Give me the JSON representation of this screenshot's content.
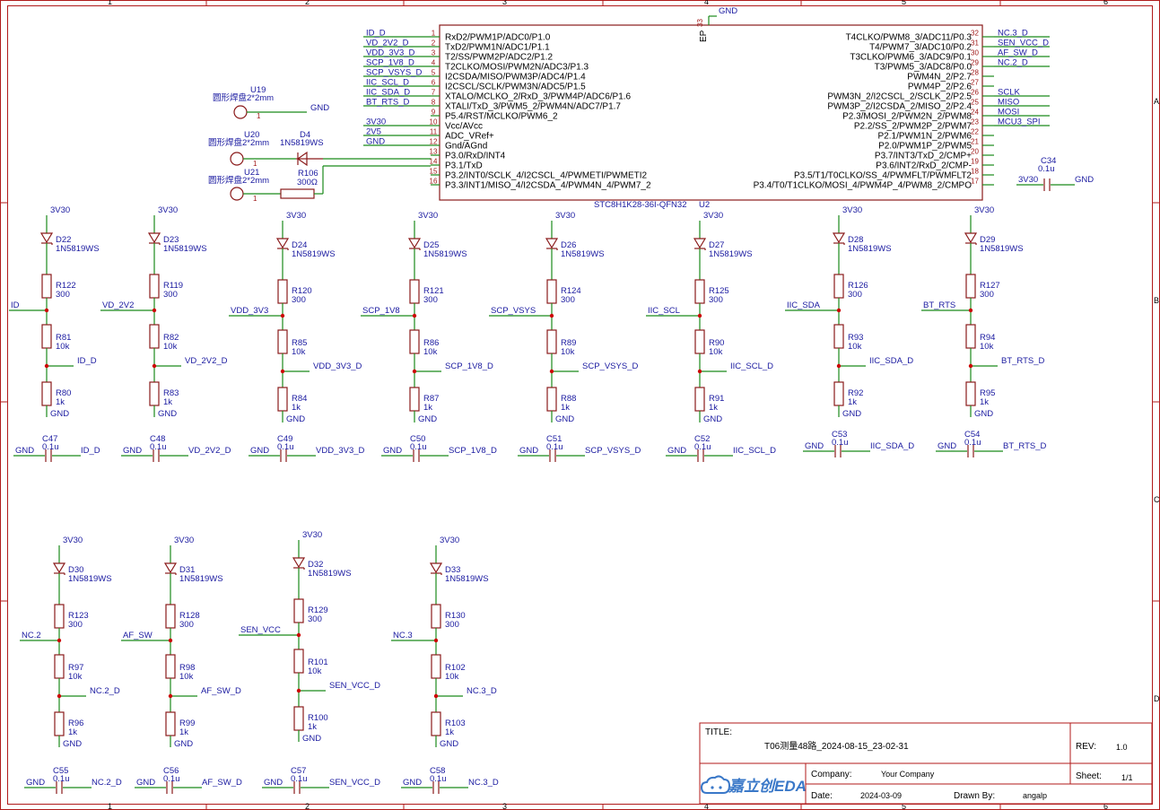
{
  "frame": {
    "cols": [
      "1",
      "2",
      "3",
      "4",
      "5",
      "6"
    ],
    "rows": [
      "A",
      "B",
      "C",
      "D"
    ]
  },
  "mcu": {
    "ref": "U2",
    "part": "STC8H1K28-36I-QFN32",
    "ep_label": "EP",
    "ep_pin": "33",
    "ep_net": "GND",
    "left_pins": [
      {
        "num": "1",
        "name": "RxD2/PWM1P/ADC0/P1.0",
        "net": "ID_D"
      },
      {
        "num": "2",
        "name": "TxD2/PWM1N/ADC1/P1.1",
        "net": "VD_2V2_D"
      },
      {
        "num": "3",
        "name": "T2/SS/PWM2P/ADC2/P1.2",
        "net": "VDD_3V3_D"
      },
      {
        "num": "4",
        "name": "T2CLKO/MOSI/PWM2N/ADC3/P1.3",
        "net": "SCP_1V8_D"
      },
      {
        "num": "5",
        "name": "I2CSDA/MISO/PWM3P/ADC4/P1.4",
        "net": "SCP_VSYS_D"
      },
      {
        "num": "6",
        "name": "I2CSCL/SCLK/PWM3N/ADC5/P1.5",
        "net": "IIC_SCL_D"
      },
      {
        "num": "7",
        "name": "XTALO/MCLKO_2/RxD_3/PWM4P/ADC6/P1.6",
        "net": "IIC_SDA_D"
      },
      {
        "num": "8",
        "name": "XTALI/TxD_3/PWM5_2/PWM4N/ADC7/P1.7",
        "net": "BT_RTS_D"
      },
      {
        "num": "9",
        "name": "P5.4/RST/MCLKO/PWM6_2",
        "net": ""
      },
      {
        "num": "10",
        "name": "Vcc/AVcc",
        "net": "3V30"
      },
      {
        "num": "11",
        "name": "ADC_VRef+",
        "net": "2V5"
      },
      {
        "num": "12",
        "name": "Gnd/AGnd",
        "net": "GND"
      },
      {
        "num": "13",
        "name": "P3.0/RxD/INT4",
        "net": ""
      },
      {
        "num": "14",
        "name": "P3.1/TxD",
        "net": ""
      },
      {
        "num": "15",
        "name": "P3.2/INT0/SCLK_4/I2CSCL_4/PWMETI/PWMETI2",
        "net": ""
      },
      {
        "num": "16",
        "name": "P3.3/INT1/MISO_4/I2CSDA_4/PWM4N_4/PWM7_2",
        "net": ""
      }
    ],
    "right_pins": [
      {
        "num": "32",
        "name": "T4CLKO/PWM8_3/ADC11/P0.3",
        "net": "NC.3_D"
      },
      {
        "num": "31",
        "name": "T4/PWM7_3/ADC10/P0.2",
        "net": "SEN_VCC_D"
      },
      {
        "num": "30",
        "name": "T3CLKO/PWM6_3/ADC9/P0.1",
        "net": "AF_SW_D"
      },
      {
        "num": "29",
        "name": "T3/PWM5_3/ADC8/P0.0",
        "net": "NC.2_D"
      },
      {
        "num": "28",
        "name": "PWM4N_2/P2.7",
        "net": ""
      },
      {
        "num": "27",
        "name": "PWM4P_2/P2.6",
        "net": ""
      },
      {
        "num": "26",
        "name": "PWM3N_2/I2CSCL_2/SCLK_2/P2.5",
        "net": "SCLK"
      },
      {
        "num": "25",
        "name": "PWM3P_2/I2CSDA_2/MISO_2/P2.4",
        "net": "MISO"
      },
      {
        "num": "24",
        "name": "P2.3/MOSI_2/PWM2N_2/PWM8",
        "net": "MOSI"
      },
      {
        "num": "23",
        "name": "P2.2/SS_2/PWM2P_2/PWM7",
        "net": "MCU3_SPI"
      },
      {
        "num": "22",
        "name": "P2.1/PWM1N_2/PWM6",
        "net": ""
      },
      {
        "num": "21",
        "name": "P2.0/PWM1P_2/PWM5",
        "net": ""
      },
      {
        "num": "20",
        "name": "P3.7/INT3/TxD_2/CMP+",
        "net": ""
      },
      {
        "num": "19",
        "name": "P3.6/INT2/RxD_2/CMP-",
        "net": ""
      },
      {
        "num": "18",
        "name": "P3.5/T1/T0CLKO/SS_4/PWMFLT/PWMFLT2",
        "net": ""
      },
      {
        "num": "17",
        "name": "P3.4/T0/T1CLKO/MOSI_4/PWM4P_4/PWM8_2/CMPO",
        "net": ""
      }
    ]
  },
  "pads": [
    {
      "ref": "U19",
      "part": "圆形焊盘2*2mm",
      "pin": "1",
      "net": "GND"
    },
    {
      "ref": "U20",
      "part": "圆形焊盘2*2mm",
      "pin": "1",
      "net": ""
    },
    {
      "ref": "U21",
      "part": "圆形焊盘2*2mm",
      "pin": "1",
      "net": ""
    }
  ],
  "d4": {
    "ref": "D4",
    "part": "1N5819WS"
  },
  "r106": {
    "ref": "R106",
    "value": "300Ω"
  },
  "c34": {
    "ref": "C34",
    "value": "0.1u",
    "left_net": "3V30",
    "right_net": "GND"
  },
  "channels": [
    {
      "supply": "3V30",
      "diode": "D22",
      "dpart": "1N5819WS",
      "rtop": "R122",
      "rtopv": "300",
      "input": "ID",
      "rmid": "R81",
      "rmidv": "10k",
      "out": "ID_D",
      "rbot": "R80",
      "rbotv": "1k",
      "gnd": "GND",
      "cap": "C47",
      "capv": "0.1u",
      "capgnd": "GND",
      "capnet": "ID_D"
    },
    {
      "supply": "3V30",
      "diode": "D23",
      "dpart": "1N5819WS",
      "rtop": "R119",
      "rtopv": "300",
      "input": "VD_2V2",
      "rmid": "R82",
      "rmidv": "10k",
      "out": "VD_2V2_D",
      "rbot": "R83",
      "rbotv": "1k",
      "gnd": "GND",
      "cap": "C48",
      "capv": "0.1u",
      "capgnd": "GND",
      "capnet": "VD_2V2_D"
    },
    {
      "supply": "3V30",
      "diode": "D24",
      "dpart": "1N5819WS",
      "rtop": "R120",
      "rtopv": "300",
      "input": "VDD_3V3",
      "rmid": "R85",
      "rmidv": "10k",
      "out": "VDD_3V3_D",
      "rbot": "R84",
      "rbotv": "1k",
      "gnd": "GND",
      "cap": "C49",
      "capv": "0.1u",
      "capgnd": "GND",
      "capnet": "VDD_3V3_D"
    },
    {
      "supply": "3V30",
      "diode": "D25",
      "dpart": "1N5819WS",
      "rtop": "R121",
      "rtopv": "300",
      "input": "SCP_1V8",
      "rmid": "R86",
      "rmidv": "10k",
      "out": "SCP_1V8_D",
      "rbot": "R87",
      "rbotv": "1k",
      "gnd": "GND",
      "cap": "C50",
      "capv": "0.1u",
      "capgnd": "GND",
      "capnet": "SCP_1V8_D"
    },
    {
      "supply": "3V30",
      "diode": "D26",
      "dpart": "1N5819WS",
      "rtop": "R124",
      "rtopv": "300",
      "input": "SCP_VSYS",
      "rmid": "R89",
      "rmidv": "10k",
      "out": "SCP_VSYS_D",
      "rbot": "R88",
      "rbotv": "1k",
      "gnd": "GND",
      "cap": "C51",
      "capv": "0.1u",
      "capgnd": "GND",
      "capnet": "SCP_VSYS_D"
    },
    {
      "supply": "3V30",
      "diode": "D27",
      "dpart": "1N5819WS",
      "rtop": "R125",
      "rtopv": "300",
      "input": "IIC_SCL",
      "rmid": "R90",
      "rmidv": "10k",
      "out": "IIC_SCL_D",
      "rbot": "R91",
      "rbotv": "1k",
      "gnd": "GND",
      "cap": "C52",
      "capv": "0.1u",
      "capgnd": "GND",
      "capnet": "IIC_SCL_D"
    },
    {
      "supply": "3V30",
      "diode": "D28",
      "dpart": "1N5819WS",
      "rtop": "R126",
      "rtopv": "300",
      "input": "IIC_SDA",
      "rmid": "R93",
      "rmidv": "10k",
      "out": "IIC_SDA_D",
      "rbot": "R92",
      "rbotv": "1k",
      "gnd": "GND",
      "cap": "C53",
      "capv": "0.1u",
      "capgnd": "GND",
      "capnet": "IIC_SDA_D"
    },
    {
      "supply": "3V30",
      "diode": "D29",
      "dpart": "1N5819WS",
      "rtop": "R127",
      "rtopv": "300",
      "input": "BT_RTS",
      "rmid": "R94",
      "rmidv": "10k",
      "out": "BT_RTS_D",
      "rbot": "R95",
      "rbotv": "1k",
      "gnd": "GND",
      "cap": "C54",
      "capv": "0.1u",
      "capgnd": "GND",
      "capnet": "BT_RTS_D"
    },
    {
      "supply": "3V30",
      "diode": "D30",
      "dpart": "1N5819WS",
      "rtop": "R123",
      "rtopv": "300",
      "input": "NC.2",
      "rmid": "R97",
      "rmidv": "10k",
      "out": "NC.2_D",
      "rbot": "R96",
      "rbotv": "1k",
      "gnd": "GND",
      "cap": "C55",
      "capv": "0.1u",
      "capgnd": "GND",
      "capnet": "NC.2_D"
    },
    {
      "supply": "3V30",
      "diode": "D31",
      "dpart": "1N5819WS",
      "rtop": "R128",
      "rtopv": "300",
      "input": "AF_SW",
      "rmid": "R98",
      "rmidv": "10k",
      "out": "AF_SW_D",
      "rbot": "R99",
      "rbotv": "1k",
      "gnd": "GND",
      "cap": "C56",
      "capv": "0.1u",
      "capgnd": "GND",
      "capnet": "AF_SW_D"
    },
    {
      "supply": "3V30",
      "diode": "D32",
      "dpart": "1N5819WS",
      "rtop": "R129",
      "rtopv": "300",
      "input": "SEN_VCC",
      "rmid": "R101",
      "rmidv": "10k",
      "out": "SEN_VCC_D",
      "rbot": "R100",
      "rbotv": "1k",
      "gnd": "GND",
      "cap": "C57",
      "capv": "0.1u",
      "capgnd": "GND",
      "capnet": "SEN_VCC_D"
    },
    {
      "supply": "3V30",
      "diode": "D33",
      "dpart": "1N5819WS",
      "rtop": "R130",
      "rtopv": "300",
      "input": "NC.3",
      "rmid": "R102",
      "rmidv": "10k",
      "out": "NC.3_D",
      "rbot": "R103",
      "rbotv": "1k",
      "gnd": "GND",
      "cap": "C58",
      "capv": "0.1u",
      "capgnd": "GND",
      "capnet": "NC.3_D"
    }
  ],
  "title_block": {
    "title_label": "TITLE:",
    "title": "T06测量48路_2024-08-15_23-02-31",
    "rev_label": "REV:",
    "rev": "1.0",
    "company_label": "Company:",
    "company": "Your Company",
    "sheet_label": "Sheet:",
    "sheet": "1/1",
    "date_label": "Date:",
    "date": "2024-03-09",
    "drawn_label": "Drawn By:",
    "drawn": "angalp",
    "brand": "嘉立创EDA",
    "brand_color": "#3a78c8"
  }
}
